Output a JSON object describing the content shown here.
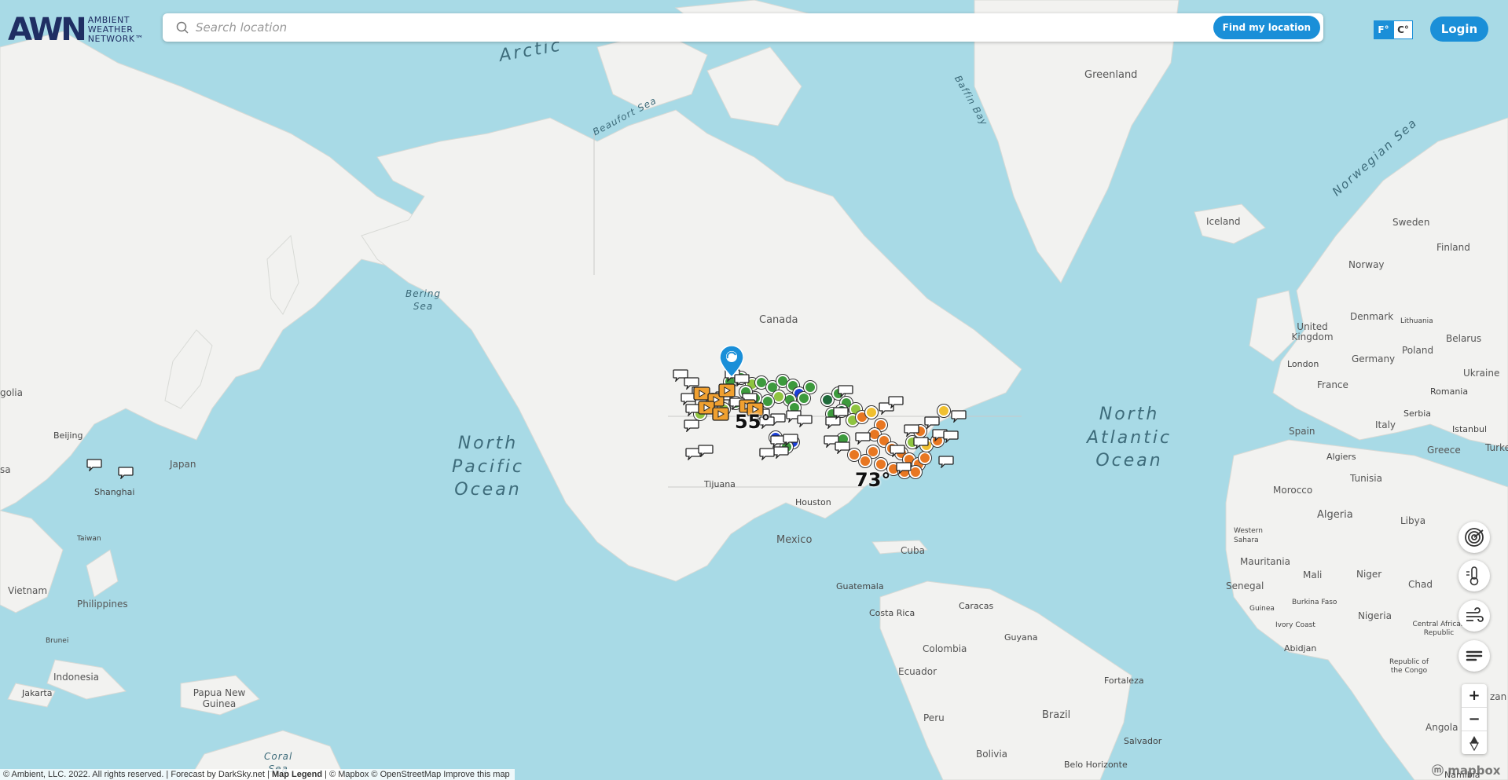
{
  "header": {
    "logo_mark": "AWN",
    "logo_text_line1": "AMBIENT",
    "logo_text_line2": "WEATHER",
    "logo_text_line3": "NETWORK™",
    "search_placeholder": "Search location",
    "find_location_label": "Find my location",
    "unit_f": "F°",
    "unit_c": "C°",
    "login_label": "Login"
  },
  "map": {
    "oceans": [
      {
        "id": "north-pacific",
        "lines": [
          "North",
          "Pacific",
          "Ocean"
        ]
      },
      {
        "id": "north-atlantic",
        "lines": [
          "North",
          "Atlantic",
          "Ocean"
        ]
      },
      {
        "id": "arctic",
        "lines": [
          "Arctic"
        ]
      },
      {
        "id": "beaufort",
        "lines": [
          "Beaufort Sea"
        ]
      },
      {
        "id": "baffin",
        "lines": [
          "Baffin Bay"
        ]
      },
      {
        "id": "norwegian",
        "lines": [
          "Norwegian Sea"
        ]
      },
      {
        "id": "bering",
        "lines": [
          "Bering",
          "Sea"
        ]
      },
      {
        "id": "coral",
        "lines": [
          "Coral",
          "Sea"
        ]
      }
    ],
    "labels": [
      {
        "id": "greenland",
        "text": "Greenland"
      },
      {
        "id": "iceland",
        "text": "Iceland"
      },
      {
        "id": "canada",
        "text": "Canada"
      },
      {
        "id": "mexico",
        "text": "Mexico"
      },
      {
        "id": "houston",
        "text": "Houston"
      },
      {
        "id": "tijuana",
        "text": "Tijuana"
      },
      {
        "id": "cuba",
        "text": "Cuba"
      },
      {
        "id": "guatemala",
        "text": "Guatemala"
      },
      {
        "id": "costa-rica",
        "text": "Costa Rica"
      },
      {
        "id": "caracas",
        "text": "Caracas"
      },
      {
        "id": "colombia",
        "text": "Colombia"
      },
      {
        "id": "guyana",
        "text": "Guyana"
      },
      {
        "id": "ecuador",
        "text": "Ecuador"
      },
      {
        "id": "peru",
        "text": "Peru"
      },
      {
        "id": "brazil",
        "text": "Brazil"
      },
      {
        "id": "bolivia",
        "text": "Bolivia"
      },
      {
        "id": "fortaleza",
        "text": "Fortaleza"
      },
      {
        "id": "salvador",
        "text": "Salvador"
      },
      {
        "id": "belo-horizonte",
        "text": "Belo Horizonte"
      },
      {
        "id": "sweden",
        "text": "Sweden"
      },
      {
        "id": "finland",
        "text": "Finland"
      },
      {
        "id": "norway",
        "text": "Norway"
      },
      {
        "id": "denmark",
        "text": "Denmark"
      },
      {
        "id": "lithuania",
        "text": "Lithuania"
      },
      {
        "id": "united-kingdom",
        "text": "United Kingdom"
      },
      {
        "id": "london",
        "text": "London"
      },
      {
        "id": "belarus",
        "text": "Belarus"
      },
      {
        "id": "poland",
        "text": "Poland"
      },
      {
        "id": "germany",
        "text": "Germany"
      },
      {
        "id": "ukraine",
        "text": "Ukraine"
      },
      {
        "id": "france",
        "text": "France"
      },
      {
        "id": "romania",
        "text": "Romania"
      },
      {
        "id": "serbia",
        "text": "Serbia"
      },
      {
        "id": "italy",
        "text": "Italy"
      },
      {
        "id": "spain",
        "text": "Spain"
      },
      {
        "id": "istanbul",
        "text": "Istanbul"
      },
      {
        "id": "greece",
        "text": "Greece"
      },
      {
        "id": "turkey",
        "text": "Turke"
      },
      {
        "id": "algiers",
        "text": "Algiers"
      },
      {
        "id": "tunisia",
        "text": "Tunisia"
      },
      {
        "id": "morocco",
        "text": "Morocco"
      },
      {
        "id": "algeria",
        "text": "Algeria"
      },
      {
        "id": "libya",
        "text": "Libya"
      },
      {
        "id": "western-sahara",
        "text": "Western Sahara"
      },
      {
        "id": "mauritania",
        "text": "Mauritania"
      },
      {
        "id": "mali",
        "text": "Mali"
      },
      {
        "id": "niger",
        "text": "Niger"
      },
      {
        "id": "chad",
        "text": "Chad"
      },
      {
        "id": "senegal",
        "text": "Senegal"
      },
      {
        "id": "guinea",
        "text": "Guinea"
      },
      {
        "id": "burkina-faso",
        "text": "Burkina Faso"
      },
      {
        "id": "nigeria",
        "text": "Nigeria"
      },
      {
        "id": "ivory-coast",
        "text": "Ivory Coast"
      },
      {
        "id": "car",
        "text": "Central African Republic"
      },
      {
        "id": "abidjan",
        "text": "Abidjan"
      },
      {
        "id": "congo",
        "text": "Republic of the Congo"
      },
      {
        "id": "angola",
        "text": "Angola"
      },
      {
        "id": "namibia",
        "text": "Namibia"
      },
      {
        "id": "zan",
        "text": "zan"
      },
      {
        "id": "mongolia",
        "text": "golia"
      },
      {
        "id": "beijing",
        "text": "Beijing"
      },
      {
        "id": "japan",
        "text": "Japan"
      },
      {
        "id": "shanghai",
        "text": "Shanghai"
      },
      {
        "id": "taiwan",
        "text": "Taiwan"
      },
      {
        "id": "vietnam",
        "text": "Vietnam"
      },
      {
        "id": "philippines",
        "text": "Philippines"
      },
      {
        "id": "brunei",
        "text": "Brunei"
      },
      {
        "id": "indonesia",
        "text": "Indonesia"
      },
      {
        "id": "jakarta",
        "text": "Jakarta"
      },
      {
        "id": "papua",
        "text": "Papua New Guinea"
      },
      {
        "id": "sa",
        "text": "sa"
      }
    ],
    "temperatures": [
      {
        "id": "temp-west",
        "text": "55°"
      },
      {
        "id": "temp-east",
        "text": "73°"
      }
    ]
  },
  "controls": {
    "zoom_in": "+",
    "zoom_out": "−",
    "layers": [
      "radar-icon",
      "temperature-icon",
      "wind-icon",
      "menu-icon"
    ]
  },
  "footer": {
    "copyright": "© Ambient, LLC. 2022. All rights reserved. | Forecast by DarkSky.net |",
    "map_legend": "Map Legend",
    "credits": "| © Mapbox © OpenStreetMap  Improve this map",
    "mapbox": "mapbox"
  },
  "colors": {
    "water": "#a8dae6",
    "land": "#f2f2f0",
    "accent": "#1a8fd8",
    "logo": "#1f2e63",
    "marker_green": "#3d9a3d",
    "marker_orange": "#e87722",
    "marker_blue": "#1a3fd8"
  }
}
